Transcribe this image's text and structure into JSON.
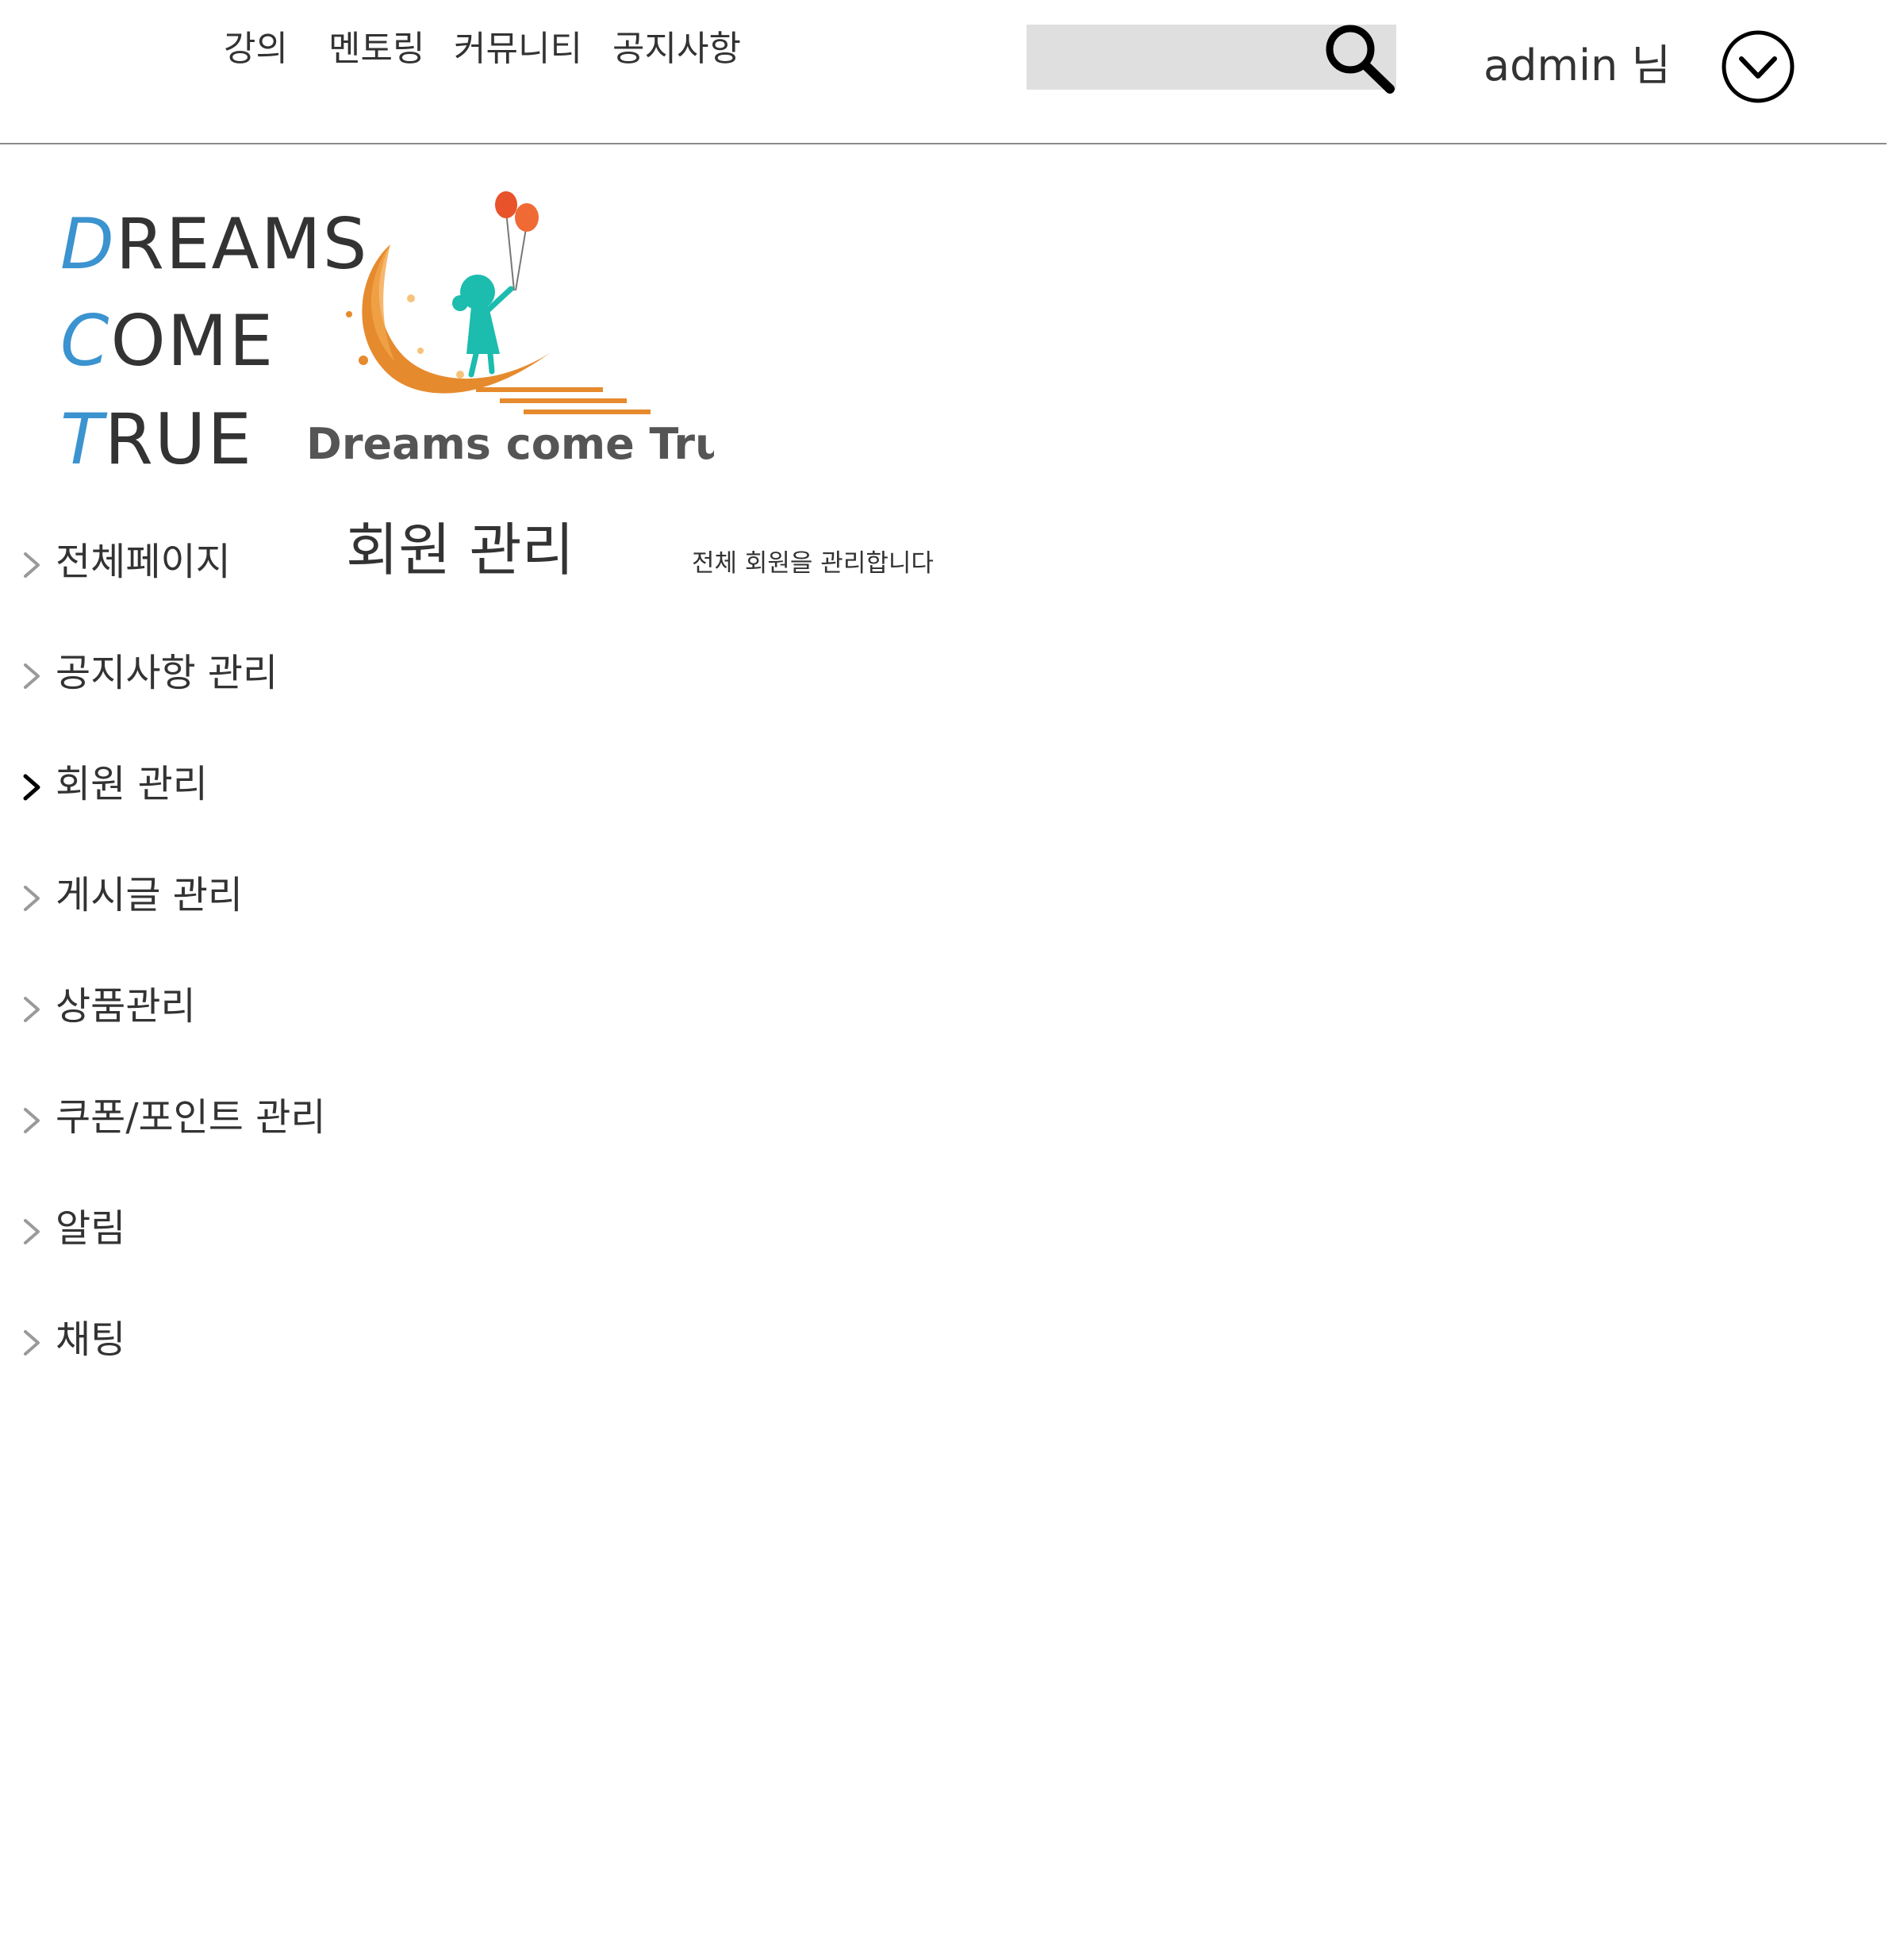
{
  "header": {
    "nav": [
      {
        "label": "강의"
      },
      {
        "label": "멘토링"
      },
      {
        "label": "커뮤니티"
      },
      {
        "label": "공지사항"
      }
    ],
    "search": {
      "value": "",
      "placeholder": ""
    },
    "user": {
      "name": "admin 님"
    }
  },
  "brand": {
    "wordmark": [
      {
        "initial": "D",
        "rest": "REAMS"
      },
      {
        "initial": "C",
        "rest": "OME"
      },
      {
        "initial": "T",
        "rest": "RUE"
      }
    ],
    "logo_text": "Dreams come True",
    "accent_color": "#3b93cf"
  },
  "sidebar": {
    "items": [
      {
        "label": "전체페이지",
        "active": false
      },
      {
        "label": "공지사항 관리",
        "active": false
      },
      {
        "label": "회원 관리",
        "active": true
      },
      {
        "label": "게시글 관리",
        "active": false
      },
      {
        "label": "상품관리",
        "active": false
      },
      {
        "label": "쿠폰/포인트 관리",
        "active": false
      },
      {
        "label": "알림",
        "active": false
      },
      {
        "label": "채팅",
        "active": false
      }
    ]
  },
  "main": {
    "title": "회원 관리",
    "description": "전체 회원을 관리합니다"
  },
  "icons": {
    "search": "search-icon",
    "user_menu": "chevron-down-circle-icon",
    "sidebar_chevron": "chevron-right-icon"
  }
}
